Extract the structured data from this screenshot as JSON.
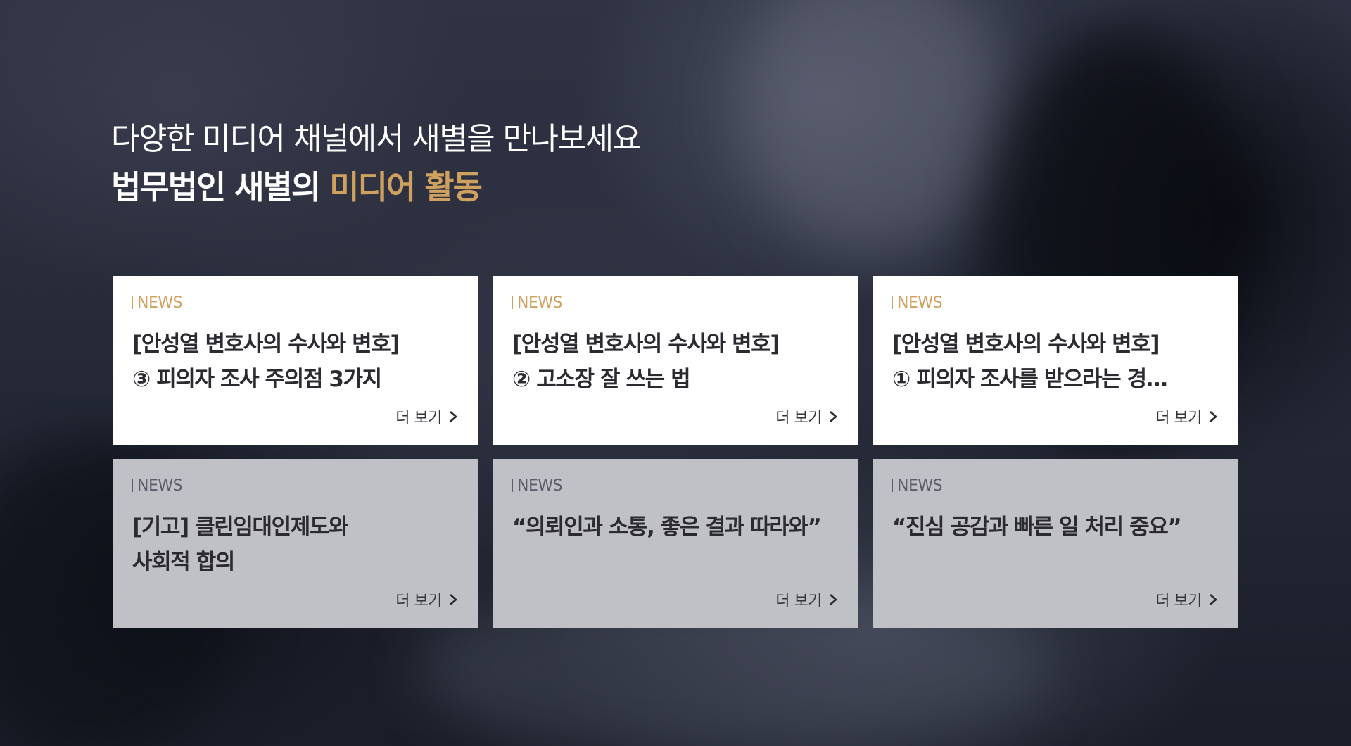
{
  "header": {
    "subtitle": "다양한 미디어 채널에서 새별을 만나보세요",
    "title_prefix": "법무법인 새별의",
    "title_accent": "미디어 활동"
  },
  "colors": {
    "accent": "#cfa15e",
    "card_light": "#ffffff",
    "card_gray": "#c0c1c6",
    "background": "#262a38"
  },
  "cards": [
    {
      "tag": "NEWS",
      "line1": "[안성열 변호사의 수사와 변호]",
      "line2": "③ 피의자 조사 주의점 3가지",
      "more": "더 보기"
    },
    {
      "tag": "NEWS",
      "line1": "[안성열 변호사의 수사와 변호]",
      "line2": "② 고소장 잘 쓰는 법",
      "more": "더 보기"
    },
    {
      "tag": "NEWS",
      "line1": "[안성열 변호사의 수사와 변호]",
      "line2": "① 피의자 조사를 받으라는 경…",
      "more": "더 보기"
    },
    {
      "tag": "NEWS",
      "line1": "[기고] 클린임대인제도와",
      "line2": "사회적 합의",
      "more": "더 보기"
    },
    {
      "tag": "NEWS",
      "line1": "“의뢰인과 소통, 좋은 결과 따라와”",
      "line2": "",
      "more": "더 보기"
    },
    {
      "tag": "NEWS",
      "line1": "“진심 공감과 빠른 일 처리 중요”",
      "line2": "",
      "more": "더 보기"
    }
  ],
  "icons": {
    "more": "chevron-right-icon"
  }
}
